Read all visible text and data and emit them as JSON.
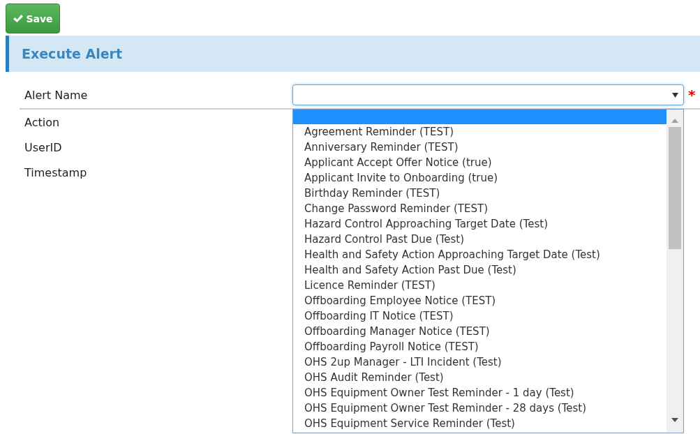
{
  "toolbar": {
    "save_button": {
      "label": "Save"
    }
  },
  "section": {
    "title": "Execute Alert"
  },
  "fields": [
    {
      "label": "Alert Name",
      "kind": "select",
      "required_mark": "*"
    },
    {
      "label": "Action",
      "kind": "text"
    },
    {
      "label": "UserID",
      "kind": "text"
    },
    {
      "label": "Timestamp",
      "kind": "text"
    }
  ],
  "dropdown": {
    "open": true,
    "empty_option_highlighted": true,
    "options": [
      {
        "label": "Agreement Reminder (TEST)",
        "selected": false
      },
      {
        "label": "Anniversary Reminder (TEST)",
        "selected": false
      },
      {
        "label": "Applicant Accept Offer Notice (true)",
        "selected": false
      },
      {
        "label": "Applicant Invite to Onboarding (true)",
        "selected": false
      },
      {
        "label": "Birthday Reminder (TEST)",
        "selected": false
      },
      {
        "label": "Change Password Reminder (TEST)",
        "selected": false
      },
      {
        "label": "Hazard Control Approaching Target Date (Test)",
        "selected": false
      },
      {
        "label": "Hazard Control Past Due (Test)",
        "selected": false
      },
      {
        "label": "Health and Safety Action Approaching Target Date (Test)",
        "selected": false
      },
      {
        "label": "Health and Safety Action Past Due (Test)",
        "selected": false
      },
      {
        "label": "Licence Reminder (TEST)",
        "selected": false
      },
      {
        "label": "Offboarding Employee Notice (TEST)",
        "selected": false
      },
      {
        "label": "Offboarding IT Notice (TEST)",
        "selected": false
      },
      {
        "label": "Offboarding Manager Notice (TEST)",
        "selected": false
      },
      {
        "label": "Offboarding Payroll Notice (TEST)",
        "selected": false
      },
      {
        "label": "OHS 2up Manager - LTI Incident (Test)",
        "selected": false
      },
      {
        "label": "OHS Audit Reminder (Test)",
        "selected": false
      },
      {
        "label": "OHS Equipment Owner Test Reminder - 1 day (Test)",
        "selected": false
      },
      {
        "label": "OHS Equipment Owner Test Reminder - 28 days (Test)",
        "selected": false
      },
      {
        "label": "OHS Equipment Service Reminder (Test)",
        "selected": false
      }
    ]
  }
}
